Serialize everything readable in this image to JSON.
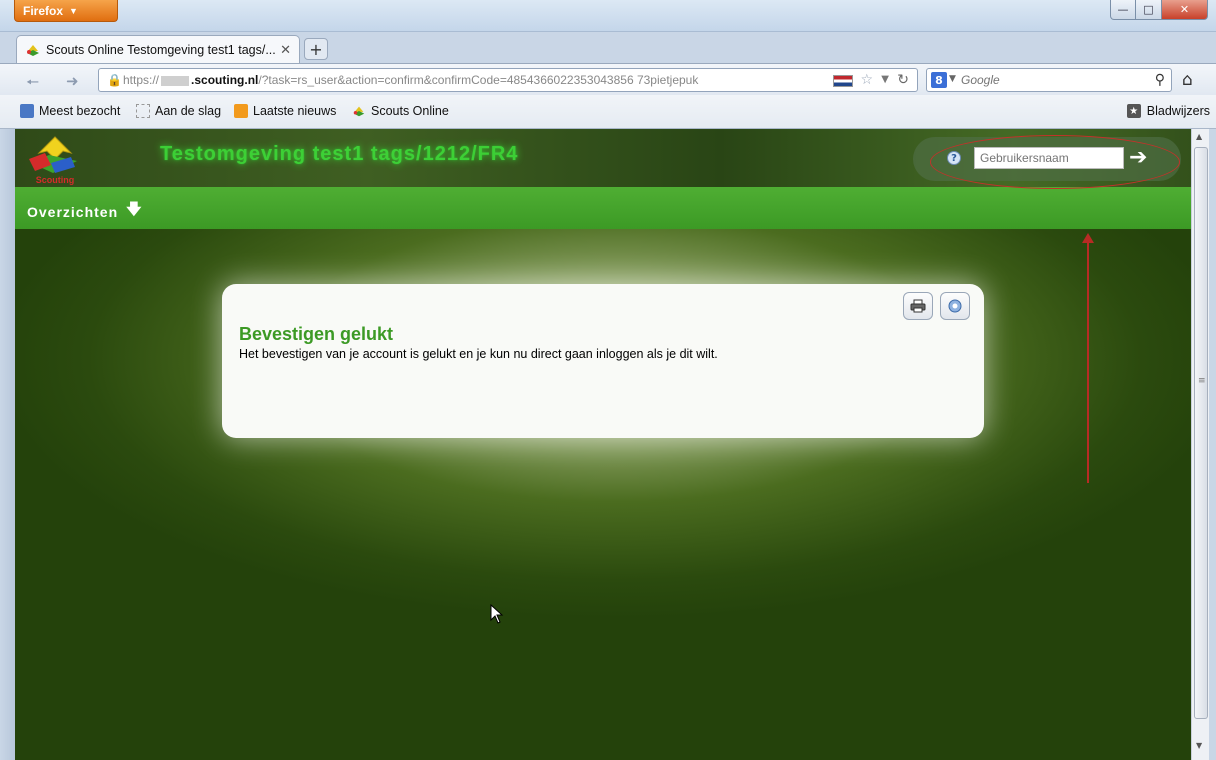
{
  "browser": {
    "app_button": "Firefox",
    "tab_title": "Scouts Online Testomgeving test1 tags/...",
    "new_tab": "+",
    "url": {
      "prefix": "https://",
      "domain": ".scouting.nl",
      "path": "/?task=rs_user&action=confirm&confirmCode=4854366022353043856 73pietjepuk"
    },
    "search": {
      "engine": "8",
      "placeholder": "Google"
    },
    "bookmarks": [
      "Meest bezocht",
      "Aan de slag",
      "Laatste nieuws",
      "Scouts Online"
    ],
    "bookmarks_menu": "Bladwijzers"
  },
  "site": {
    "logo_text": "Scouting",
    "title": "Testomgeving test1 tags/1212/FR4",
    "login": {
      "username_placeholder": "Gebruikersnaam"
    },
    "menu": {
      "overzichten": "Overzichten"
    }
  },
  "card": {
    "title": "Bevestigen gelukt",
    "message": "Het bevestigen van je account is gelukt en je kun nu direct gaan inloggen als je dit wilt."
  },
  "colors": {
    "menu_green": "#4fae33",
    "title_green": "#3c9a25",
    "annotation_red": "#c2322a"
  }
}
